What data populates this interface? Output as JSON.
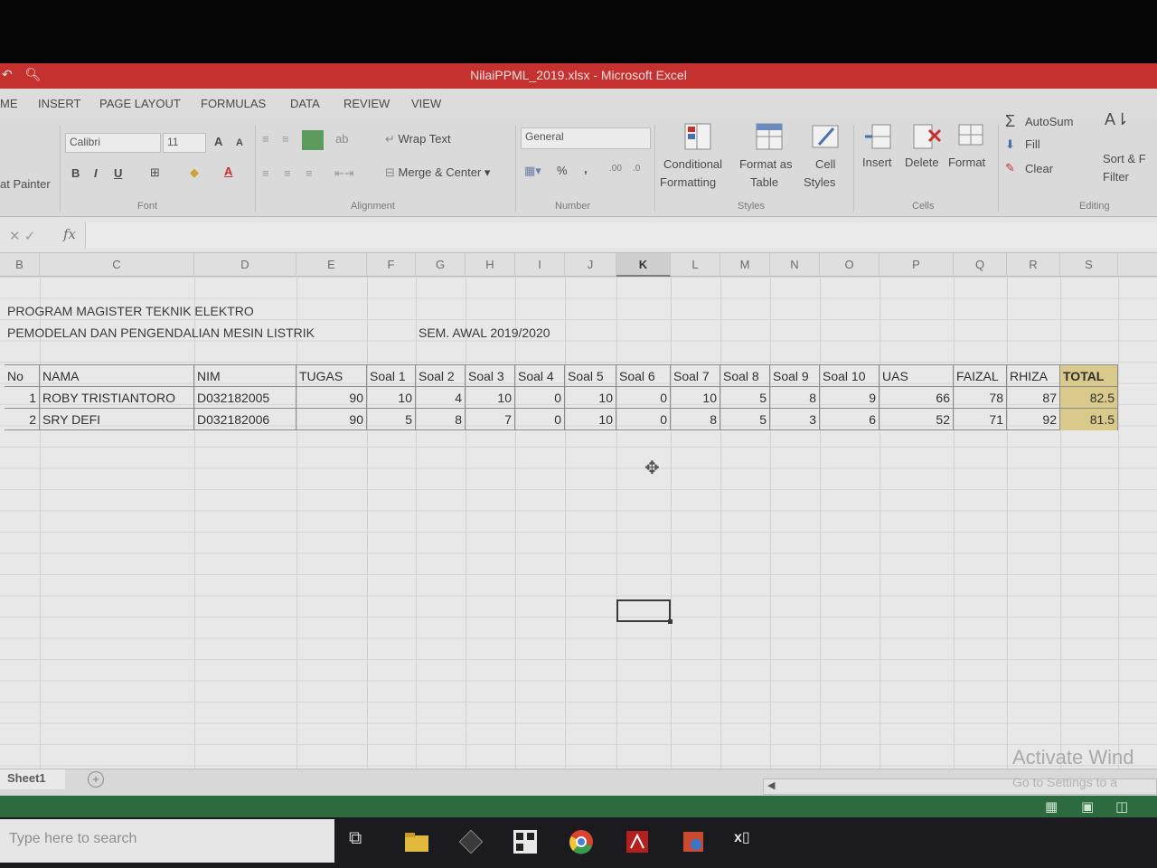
{
  "window": {
    "title": "NilaiPPML_2019.xlsx - Microsoft Excel"
  },
  "ribbon_tabs": [
    "ME",
    "INSERT",
    "PAGE LAYOUT",
    "FORMULAS",
    "DATA",
    "REVIEW",
    "VIEW"
  ],
  "ribbon": {
    "clipboard": {
      "format_painter": "at Painter"
    },
    "font": {
      "name": "Calibri",
      "size": "11",
      "label": "Font",
      "bold": "B",
      "italic": "I",
      "underline": "U",
      "grow": "A",
      "shrink": "A"
    },
    "alignment": {
      "wrap_text": "Wrap Text",
      "merge_center": "Merge & Center",
      "label": "Alignment"
    },
    "number": {
      "format": "General",
      "percent": "%",
      "comma": ",",
      "label": "Number"
    },
    "styles": {
      "conditional1": "Conditional",
      "conditional2": "Formatting",
      "format_as1": "Format as",
      "format_as2": "Table",
      "cell1": "Cell",
      "cell2": "Styles",
      "label": "Styles"
    },
    "cells": {
      "insert": "Insert",
      "delete": "Delete",
      "format": "Format",
      "label": "Cells"
    },
    "editing": {
      "autosum": "AutoSum",
      "fill": "Fill",
      "clear": "Clear",
      "sort1": "Sort & F",
      "sort2": "Filter",
      "label": "Editing"
    }
  },
  "formula_bar": {
    "fx": "fx"
  },
  "columns": [
    "B",
    "C",
    "D",
    "E",
    "F",
    "G",
    "H",
    "I",
    "J",
    "K",
    "L",
    "M",
    "N",
    "O",
    "P",
    "Q",
    "R",
    "S"
  ],
  "selected_column": "K",
  "sheet": {
    "heading1": "PROGRAM MAGISTER TEKNIK ELEKTRO",
    "heading2": "PEMODELAN DAN PENGENDALIAN MESIN LISTRIK",
    "semester": "SEM. AWAL 2019/2020",
    "table_headers": [
      "No",
      "NAMA",
      "NIM",
      "TUGAS",
      "Soal 1",
      "Soal 2",
      "Soal 3",
      "Soal 4",
      "Soal 5",
      "Soal 6",
      "Soal 7",
      "Soal 8",
      "Soal 9",
      "Soal 10",
      "UAS",
      "FAIZAL",
      "RHIZA",
      "TOTAL"
    ],
    "rows": [
      [
        "1",
        "ROBY TRISTIANTORO",
        "D032182005",
        "90",
        "10",
        "4",
        "10",
        "0",
        "10",
        "0",
        "10",
        "5",
        "8",
        "9",
        "66",
        "78",
        "87",
        "82.5"
      ],
      [
        "2",
        "SRY DEFI",
        "D032182006",
        "90",
        "5",
        "8",
        "7",
        "0",
        "10",
        "0",
        "8",
        "5",
        "3",
        "6",
        "52",
        "71",
        "92",
        "81.5"
      ]
    ]
  },
  "sheet_tabs": [
    "Sheet1"
  ],
  "watermark": {
    "line1": "Activate Wind",
    "line2": "Go to Settings to a"
  },
  "taskbar": {
    "search_placeholder": "Type here to search"
  }
}
